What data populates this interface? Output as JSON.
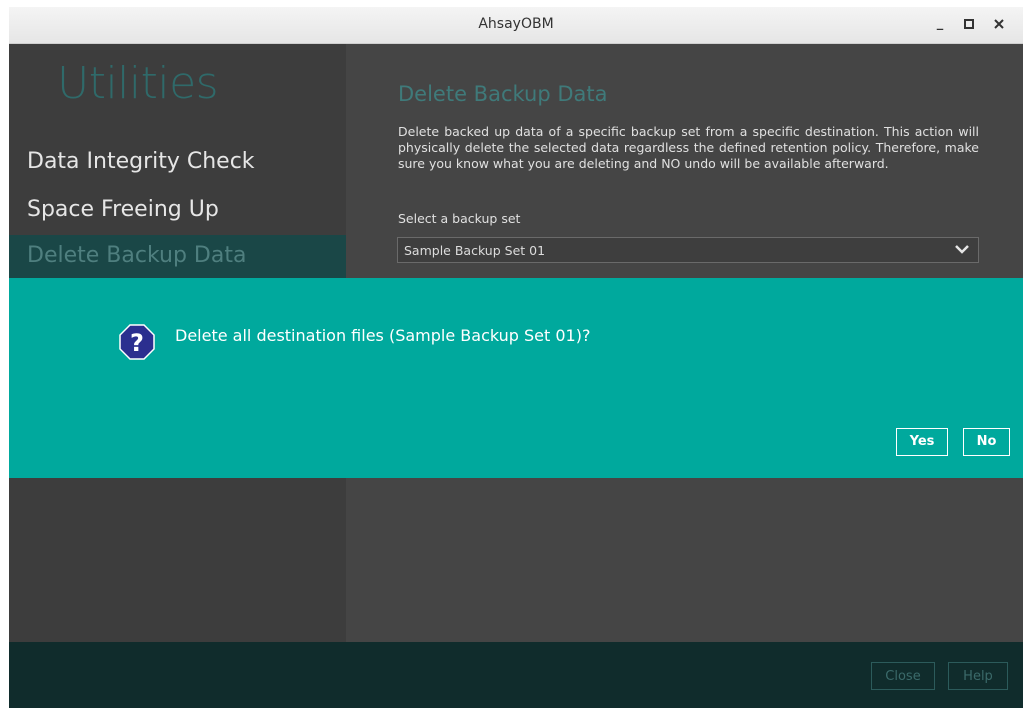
{
  "window": {
    "title": "AhsayOBM",
    "controls": {
      "minimize": "_",
      "maximize": "□",
      "close": "×"
    }
  },
  "sidebar": {
    "heading": "Utilities",
    "items": [
      {
        "label": "Data Integrity Check",
        "active": false
      },
      {
        "label": "Space Freeing Up",
        "active": false
      },
      {
        "label": "Delete Backup Data",
        "active": true
      }
    ]
  },
  "main": {
    "title": "Delete Backup Data",
    "description": "Delete backed up data of a specific backup set from a specific destination. This action will physically delete the selected data regardless the defined retention policy. Therefore, make sure you know what you are deleting and NO undo will be available afterward.",
    "select_label": "Select a backup set",
    "select_value": "Sample Backup Set 01"
  },
  "dialog": {
    "icon": "question-icon",
    "message": "Delete all destination files (Sample Backup Set 01)?",
    "yes_label": "Yes",
    "no_label": "No"
  },
  "footer": {
    "close_label": "Close",
    "help_label": "Help"
  },
  "colors": {
    "accent": "#00a99d",
    "sidebar_active": "#1a4747",
    "footer": "#102c2c",
    "icon_bg": "#2b2f8f"
  }
}
